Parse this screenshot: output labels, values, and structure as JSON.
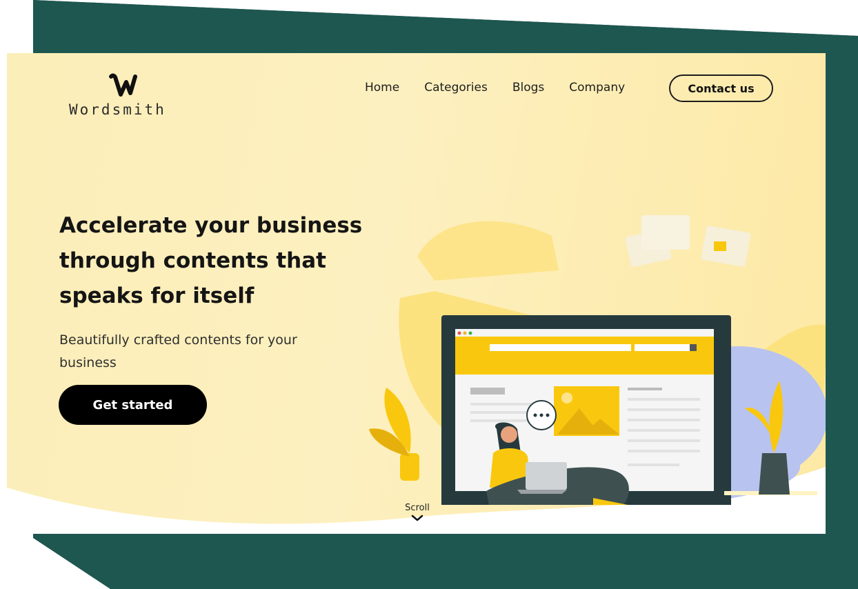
{
  "brand": {
    "name": "Wordsmith",
    "logo_icon": "w-logo-icon"
  },
  "nav": {
    "items": [
      {
        "label": "Home"
      },
      {
        "label": "Categories"
      },
      {
        "label": "Blogs"
      },
      {
        "label": "Company"
      }
    ],
    "contact_label": "Contact us"
  },
  "hero": {
    "title": "Accelerate your business\nthrough  contents that\nspeaks for itself",
    "subtitle": "Beautifully crafted contents for your business",
    "cta_label": "Get started"
  },
  "scroll": {
    "label": "Scroll",
    "icon": "chevron-down-icon"
  },
  "colors": {
    "accent_yellow": "#f9c80e",
    "dark_teal": "#1e5650",
    "hero_bg": "#fdf0c0",
    "button_black": "#000000"
  }
}
